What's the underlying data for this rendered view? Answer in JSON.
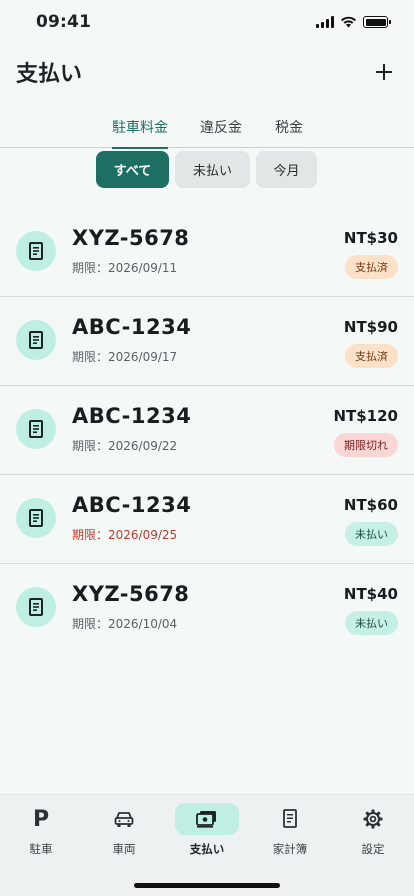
{
  "status_bar": {
    "time": "09:41"
  },
  "header": {
    "title": "支払い",
    "add_icon": "plus-icon"
  },
  "tabs": [
    {
      "label": "駐車料金",
      "active": true
    },
    {
      "label": "違反金",
      "active": false
    },
    {
      "label": "税金",
      "active": false
    }
  ],
  "filters": [
    {
      "label": "すべて",
      "active": true
    },
    {
      "label": "未払い",
      "active": false
    },
    {
      "label": "今月",
      "active": false
    }
  ],
  "payments": [
    {
      "plate": "XYZ-5678",
      "due": "期限：2026/09/11",
      "amount": "NT$30",
      "status": "支払済",
      "status_type": "paid",
      "icon": "receipt-icon"
    },
    {
      "plate": "ABC-1234",
      "due": "期限：2026/09/17",
      "amount": "NT$90",
      "status": "支払済",
      "status_type": "paid",
      "icon": "receipt-icon"
    },
    {
      "plate": "ABC-1234",
      "due": "期限：2026/09/22",
      "amount": "NT$120",
      "status": "期限切れ",
      "status_type": "expired",
      "icon": "receipt-icon"
    },
    {
      "plate": "ABC-1234",
      "due": "期限：2026/09/25",
      "amount": "NT$60",
      "status": "未払い",
      "status_type": "unpaid",
      "due_highlight": true,
      "icon": "receipt-icon"
    },
    {
      "plate": "XYZ-5678",
      "due": "期限：2026/10/04",
      "amount": "NT$40",
      "status": "未払い",
      "status_type": "unpaid",
      "icon": "receipt-icon"
    }
  ],
  "bottom_nav": [
    {
      "label": "駐車",
      "icon": "parking-icon",
      "active": false
    },
    {
      "label": "車両",
      "icon": "car-icon",
      "active": false
    },
    {
      "label": "支払い",
      "icon": "payment-icon",
      "active": true
    },
    {
      "label": "家計簿",
      "icon": "ledger-icon",
      "active": false
    },
    {
      "label": "設定",
      "icon": "gear-icon",
      "active": false
    }
  ],
  "colors": {
    "accent": "#1d6f63",
    "icon_bg": "#bfeee3",
    "paid_badge": "#fde0c8",
    "expired_badge": "#fbd6d6",
    "unpaid_badge": "#c6efe6",
    "overdue_text": "#c0392b"
  }
}
